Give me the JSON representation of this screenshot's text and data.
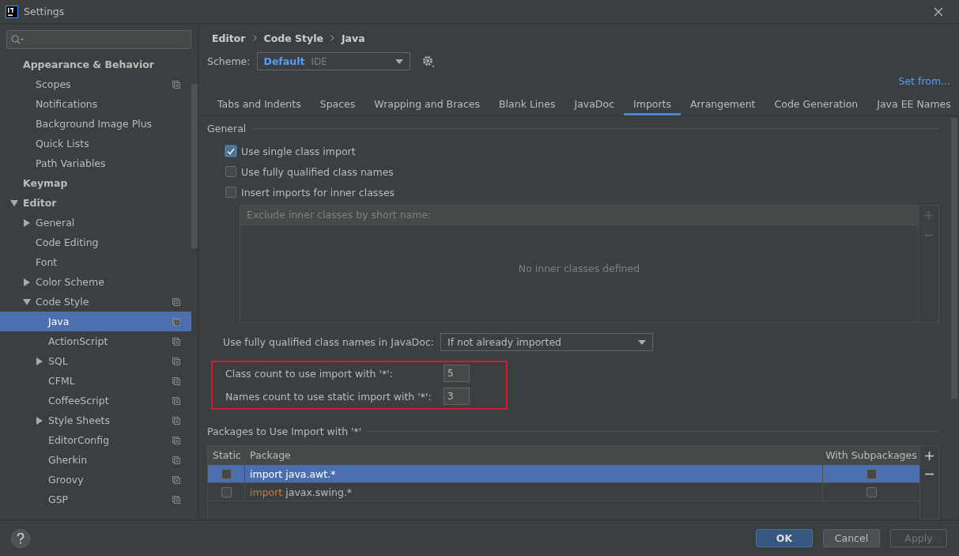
{
  "window": {
    "title": "Settings"
  },
  "sidebar": {
    "items": [
      {
        "label": "Appearance & Behavior",
        "selected": false,
        "project_icon": false,
        "children": [
          {
            "label": "Scopes",
            "selected": false,
            "project_icon": true
          },
          {
            "label": "Notifications",
            "selected": false,
            "project_icon": false
          },
          {
            "label": "Background Image Plus",
            "selected": false,
            "project_icon": false
          },
          {
            "label": "Quick Lists",
            "selected": false,
            "project_icon": false
          },
          {
            "label": "Path Variables",
            "selected": false,
            "project_icon": false
          }
        ]
      },
      {
        "label": "Keymap",
        "selected": false,
        "project_icon": false
      },
      {
        "label": "Editor",
        "selected": false,
        "project_icon": false,
        "expanded": true,
        "children": [
          {
            "label": "General",
            "selected": false,
            "project_icon": false,
            "expanded": false
          },
          {
            "label": "Code Editing",
            "selected": false,
            "project_icon": false
          },
          {
            "label": "Font",
            "selected": false,
            "project_icon": false
          },
          {
            "label": "Color Scheme",
            "selected": false,
            "project_icon": false,
            "expanded": false
          },
          {
            "label": "Code Style",
            "selected": false,
            "project_icon": true,
            "expanded": true,
            "children": [
              {
                "label": "Java",
                "selected": true,
                "project_icon": true
              },
              {
                "label": "ActionScript",
                "selected": false,
                "project_icon": true
              },
              {
                "label": "SQL",
                "selected": false,
                "project_icon": true,
                "expanded": false
              },
              {
                "label": "CFML",
                "selected": false,
                "project_icon": true
              },
              {
                "label": "CoffeeScript",
                "selected": false,
                "project_icon": true
              },
              {
                "label": "Style Sheets",
                "selected": false,
                "project_icon": true,
                "expanded": false
              },
              {
                "label": "EditorConfig",
                "selected": false,
                "project_icon": true
              },
              {
                "label": "Gherkin",
                "selected": false,
                "project_icon": true
              },
              {
                "label": "Groovy",
                "selected": false,
                "project_icon": true
              },
              {
                "label": "GSP",
                "selected": false,
                "project_icon": true
              }
            ]
          }
        ]
      }
    ]
  },
  "breadcrumb": [
    "Editor",
    "Code Style",
    "Java"
  ],
  "scheme": {
    "label": "Scheme:",
    "name": "Default",
    "qualifier": "IDE"
  },
  "set_from": "Set from...",
  "tabs": [
    {
      "label": "Tabs and Indents",
      "selected": false
    },
    {
      "label": "Spaces",
      "selected": false
    },
    {
      "label": "Wrapping and Braces",
      "selected": false
    },
    {
      "label": "Blank Lines",
      "selected": false
    },
    {
      "label": "JavaDoc",
      "selected": false
    },
    {
      "label": "Imports",
      "selected": true
    },
    {
      "label": "Arrangement",
      "selected": false
    },
    {
      "label": "Code Generation",
      "selected": false
    },
    {
      "label": "Java EE Names",
      "selected": false
    }
  ],
  "general": {
    "title": "General",
    "checkboxes": [
      {
        "label": "Use single class import",
        "checked": true
      },
      {
        "label": "Use fully qualified class names",
        "checked": false
      },
      {
        "label": "Insert imports for inner classes",
        "checked": false
      }
    ],
    "exclude_list": {
      "header": "Exclude inner classes by short name:",
      "empty_text": "No inner classes defined"
    },
    "javadoc": {
      "label": "Use fully qualified class names in JavaDoc:",
      "value": "If not already imported"
    },
    "counts": [
      {
        "label": "Class count to use import with '*':",
        "value": "5"
      },
      {
        "label": "Names count to use static import with '*':",
        "value": "3"
      }
    ]
  },
  "packages": {
    "title": "Packages to Use Import with '*'",
    "columns": [
      "Static",
      "Package",
      "With Subpackages"
    ],
    "rows": [
      {
        "static": false,
        "keyword": "import",
        "name": "java.awt.*",
        "with_subpackages": false,
        "selected": true
      },
      {
        "static": false,
        "keyword": "import",
        "name": "javax.swing.*",
        "with_subpackages": false,
        "selected": false
      }
    ]
  },
  "buttons": [
    {
      "label": "OK",
      "kind": "primary"
    },
    {
      "label": "Cancel",
      "kind": "normal"
    },
    {
      "label": "Apply",
      "kind": "disabled"
    }
  ]
}
